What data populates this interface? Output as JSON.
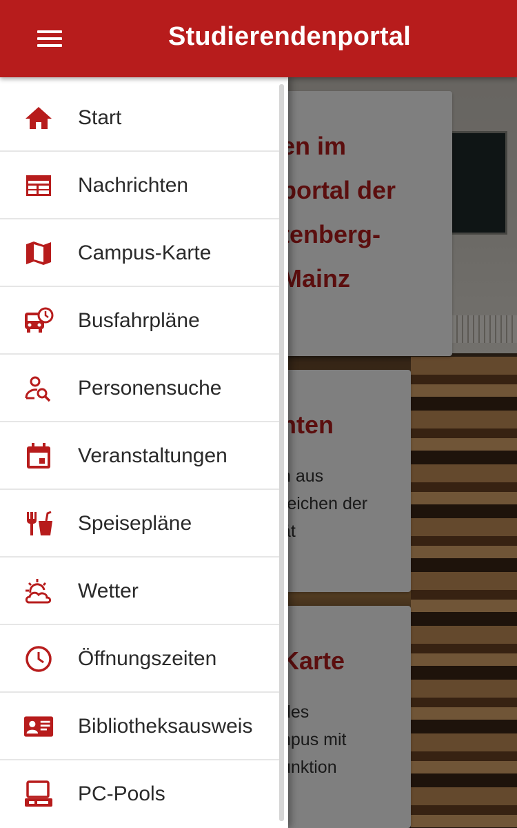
{
  "app": {
    "title": "Studierendenportal"
  },
  "colors": {
    "primary": "#b71c1c",
    "drawer_background": "#ffffff",
    "text": "#2a2a2a"
  },
  "nav": {
    "items": [
      {
        "label": "Start",
        "icon": "home-icon"
      },
      {
        "label": "Nachrichten",
        "icon": "newspaper-icon"
      },
      {
        "label": "Campus-Karte",
        "icon": "map-icon"
      },
      {
        "label": "Busfahrpläne",
        "icon": "bus-clock-icon"
      },
      {
        "label": "Personensuche",
        "icon": "person-search-icon"
      },
      {
        "label": "Veranstaltungen",
        "icon": "calendar-icon"
      },
      {
        "label": "Speisepläne",
        "icon": "food-drink-icon"
      },
      {
        "label": "Wetter",
        "icon": "weather-icon"
      },
      {
        "label": "Öffnungszeiten",
        "icon": "clock-icon"
      },
      {
        "label": "Bibliotheksausweis",
        "icon": "id-card-icon"
      },
      {
        "label": "PC-Pools",
        "icon": "computer-icon"
      }
    ]
  },
  "background_cards": [
    {
      "title_lines": [
        "en im",
        "portal der",
        "tenberg-",
        "Mainz"
      ]
    },
    {
      "title_lines": [
        "hten"
      ],
      "text_lines": [
        "n aus",
        "reichen der",
        "ät"
      ]
    },
    {
      "title_lines": [
        "Karte"
      ],
      "text_lines": [
        "des",
        "npus mit",
        "unktion"
      ]
    }
  ]
}
